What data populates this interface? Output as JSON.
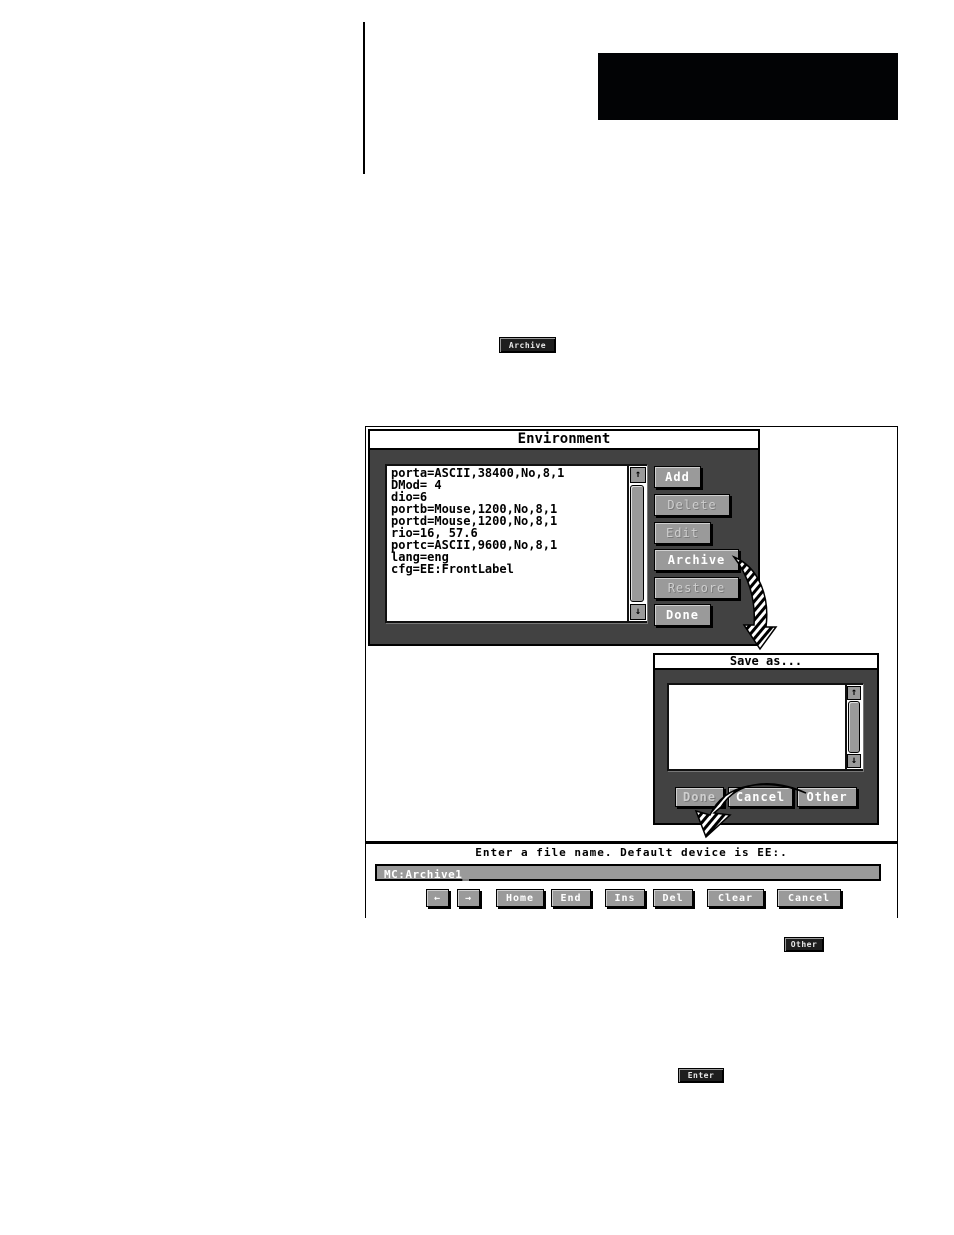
{
  "page": {
    "inline_buttons": {
      "archive": "Archive",
      "other": "Other",
      "enter": "Enter"
    }
  },
  "environment_dialog": {
    "title": "Environment",
    "entries": [
      "porta=ASCII,38400,No,8,1",
      "DMod= 4",
      "dio=6",
      "portb=Mouse,1200,No,8,1",
      "portd=Mouse,1200,No,8,1",
      "rio=16, 57.6",
      "portc=ASCII,9600,No,8,1",
      "lang=eng",
      "cfg=EE:FrontLabel"
    ],
    "scroll_up": "↑",
    "scroll_down": "↓",
    "buttons": [
      {
        "label": "Add",
        "enabled": true
      },
      {
        "label": "Delete",
        "enabled": false
      },
      {
        "label": "Edit",
        "enabled": false
      },
      {
        "label": "Archive",
        "enabled": true
      },
      {
        "label": "Restore",
        "enabled": false
      },
      {
        "label": "Done",
        "enabled": true
      }
    ]
  },
  "save_as_dialog": {
    "title": "Save as...",
    "scroll_up": "↑",
    "scroll_down": "↓",
    "buttons": [
      {
        "label": "Done",
        "enabled": false
      },
      {
        "label": "Cancel",
        "enabled": true
      },
      {
        "label": "Other",
        "enabled": true
      }
    ]
  },
  "filename_prompt": {
    "message": "Enter a file name.  Default device is EE:.",
    "value": "MC:Archive1_",
    "buttons": [
      "←",
      "→",
      "Home",
      "End",
      "Ins",
      "Del",
      "Clear",
      "Cancel"
    ]
  }
}
